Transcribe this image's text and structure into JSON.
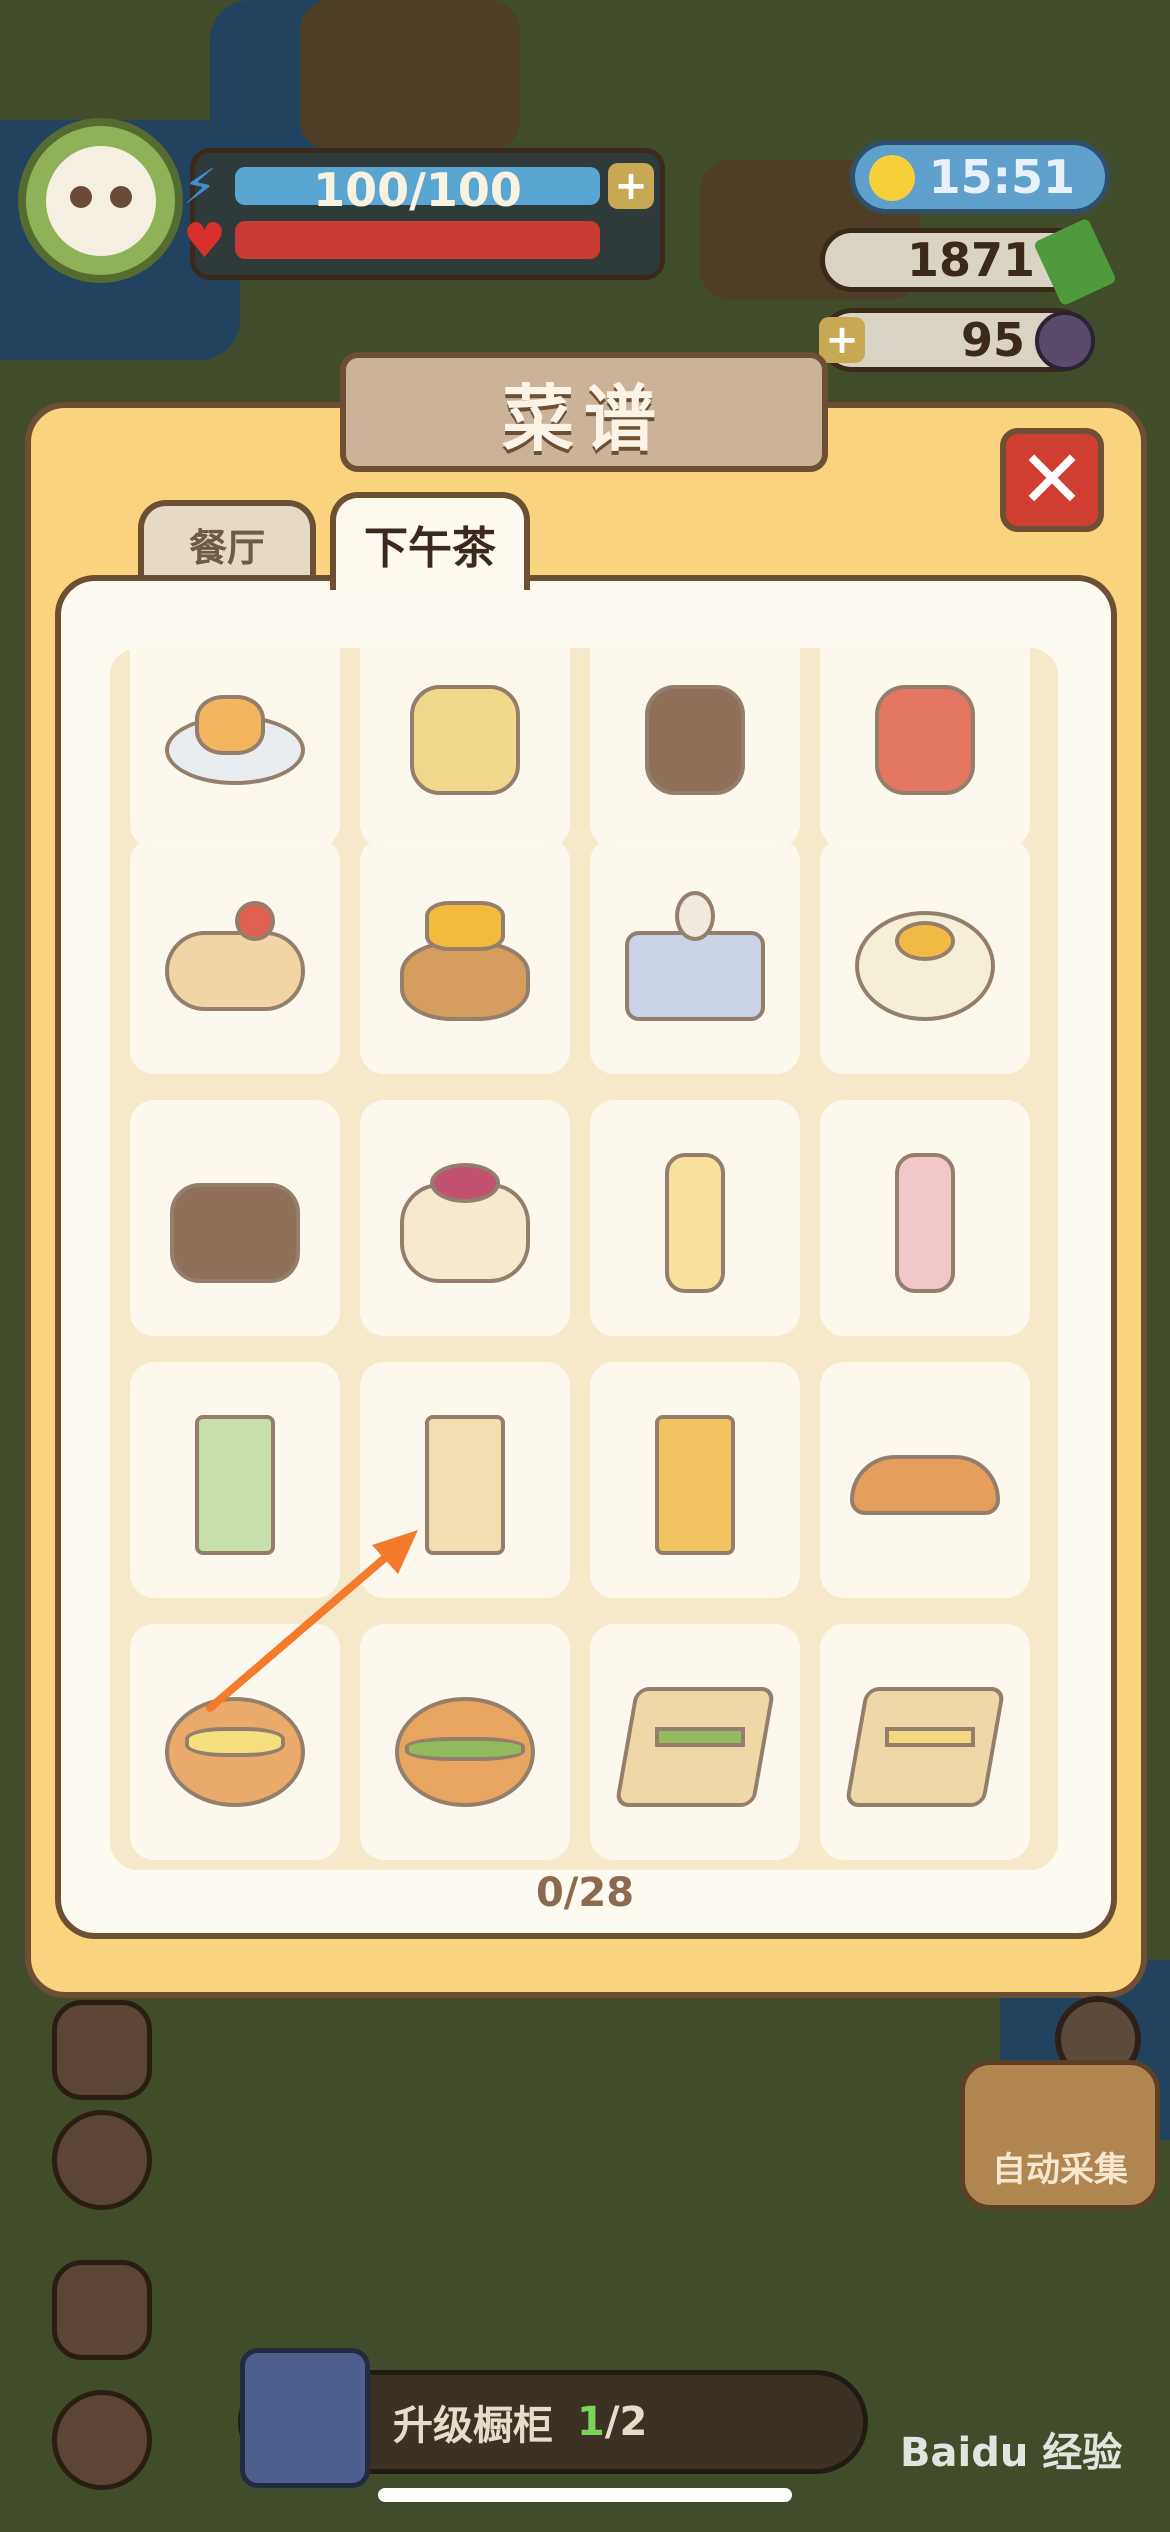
{
  "hud": {
    "energy_text": "100/100",
    "energy_plus": "+",
    "time": "15:51",
    "money": "1871",
    "gems": "95",
    "gems_plus": "+"
  },
  "modal": {
    "title": "菜谱",
    "close_label": "✕",
    "tabs": [
      {
        "label": "餐厅",
        "active": false
      },
      {
        "label": "下午茶",
        "active": true
      }
    ],
    "counter": "0/28",
    "items": [
      {
        "icon": "fruit-salad-icon"
      },
      {
        "icon": "lemon-tart-icon"
      },
      {
        "icon": "chocolate-pudding-icon"
      },
      {
        "icon": "strawberry-cake-icon"
      },
      {
        "icon": "swiss-roll-icon"
      },
      {
        "icon": "mango-cake-icon"
      },
      {
        "icon": "blueberry-jelly-icon"
      },
      {
        "icon": "orange-cream-cake-icon"
      },
      {
        "icon": "chocolate-cake-icon"
      },
      {
        "icon": "berry-tart-icon"
      },
      {
        "icon": "lemon-juice-bottle-icon"
      },
      {
        "icon": "strawberry-milk-bottle-icon"
      },
      {
        "icon": "green-milk-carton-icon"
      },
      {
        "icon": "plain-milk-carton-icon"
      },
      {
        "icon": "orange-milk-carton-icon"
      },
      {
        "icon": "taco-icon"
      },
      {
        "icon": "egg-burger-icon"
      },
      {
        "icon": "lettuce-burger-icon"
      },
      {
        "icon": "club-sandwich-icon"
      },
      {
        "icon": "egg-sandwich-icon"
      }
    ]
  },
  "bottom": {
    "upgrade_label": "升级橱柜",
    "upgrade_current": "1",
    "upgrade_total": "/2",
    "auto_collect": "自动采集"
  },
  "watermark": "Baidu 经验",
  "colors": {
    "modal_bg": "#f9d37d",
    "border": "#6d4f33",
    "panel_bg": "#fdfaf1",
    "close_red": "#cf3e31",
    "arrow": "#f47a2c"
  }
}
